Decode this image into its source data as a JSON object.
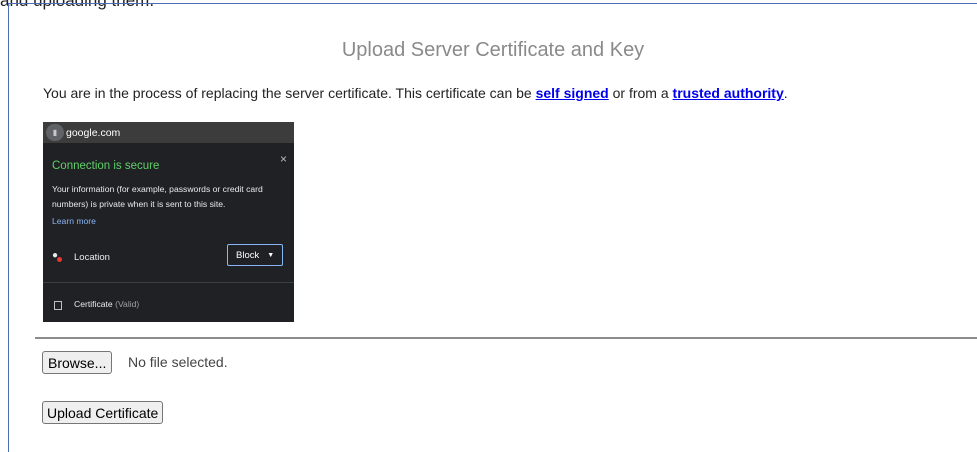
{
  "fragment_text": "and uploading them.",
  "page": {
    "title": "Upload Server Certificate and Key",
    "intro": {
      "before": "You are in the process of replacing the server certificate. This certificate can be ",
      "link1": "self signed",
      "middle": " or from a ",
      "link2": "trusted authority",
      "after": "."
    }
  },
  "popup": {
    "domain": "google.com",
    "close_glyph": "×",
    "secure_heading": "Connection is secure",
    "info": "Your information (for example, passwords or credit card numbers) is private when it is sent to this site.",
    "learn_more": "Learn more",
    "location_label": "Location",
    "location_value": "Block",
    "certificate_label": "Certificate",
    "certificate_status": "(Valid)"
  },
  "file": {
    "browse_label": "Browse...",
    "status": "No file selected."
  },
  "upload_label": "Upload Certificate",
  "colors": {
    "link": "#0000ee",
    "secure_green": "#5fd068",
    "popup_bg": "#202124",
    "frame_border": "#4a6fb5"
  }
}
